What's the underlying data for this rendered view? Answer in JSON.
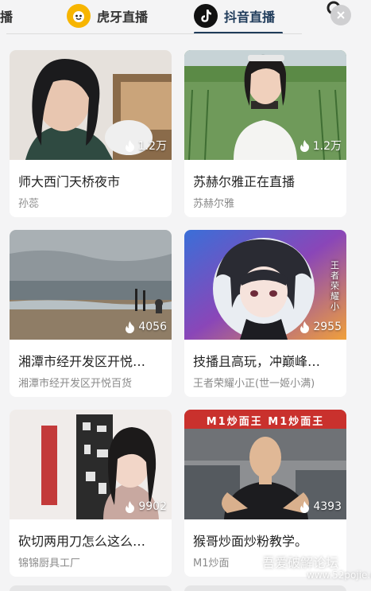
{
  "tabs": [
    {
      "label": "播"
    },
    {
      "label": "虎牙直播"
    },
    {
      "label": "抖音直播"
    }
  ],
  "icons": {
    "huya": "huya-logo-icon",
    "douyin": "douyin-logo-icon",
    "search": "search-icon",
    "close": "close-icon",
    "viewer": "flame-icon"
  },
  "colors": {
    "active_tab": "#1f3b5a",
    "huya": "#f7b500",
    "background": "#f4f4f5"
  },
  "cards": [
    {
      "title": "师大西门天桥夜市",
      "streamer": "孙蕊",
      "viewers": "1.2万"
    },
    {
      "title": "苏赫尔雅正在直播",
      "streamer": "苏赫尔雅",
      "viewers": "1.2万"
    },
    {
      "title": "湘潭市经开发区开悦…",
      "streamer": "湘潭市经开发区开悦百货",
      "viewers": "4056"
    },
    {
      "title": "技播且高玩，冲巅峰…",
      "streamer": "王者荣耀小正(世一姬小满)",
      "viewers": "2955"
    },
    {
      "title": "砍切两用刀怎么这么…",
      "streamer": "锦锦厨具工厂",
      "viewers": "9902"
    },
    {
      "title": "猴哥炒面炒粉教学。",
      "streamer": "M1炒面",
      "viewers": "4393"
    }
  ],
  "thumb_text": {
    "card4_overlay": "王者荣耀小",
    "card6_sign": "M1炒面王 M1炒面王"
  },
  "watermark": {
    "main": "吾爱破解论坛",
    "url": "www.52pojie.cn"
  }
}
